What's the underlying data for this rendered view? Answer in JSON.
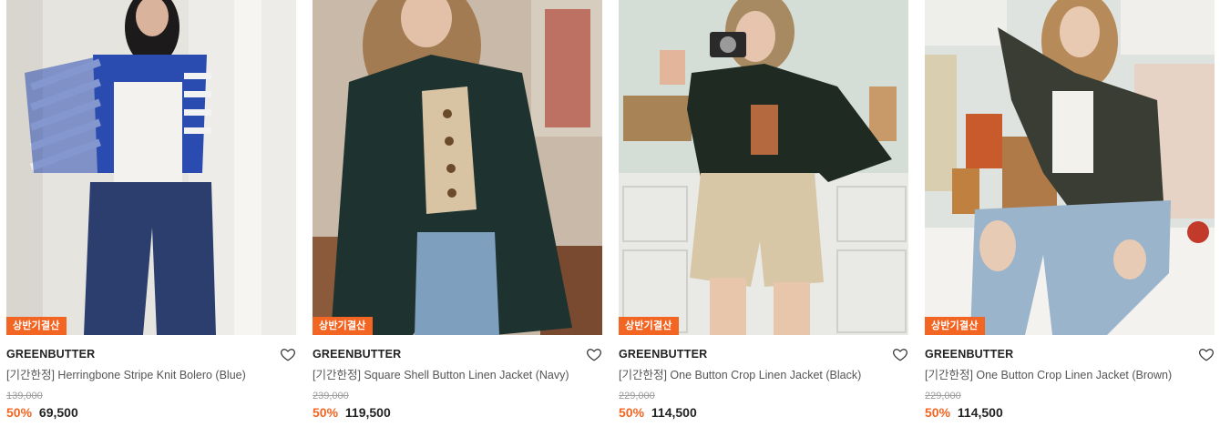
{
  "products": [
    {
      "badge": "상반기결산",
      "brand": "GREENBUTTER",
      "name": "[기간한정] Herringbone Stripe Knit Bolero (Blue)",
      "original_price": "139,000",
      "discount": "50%",
      "price": "69,500"
    },
    {
      "badge": "상반기결산",
      "brand": "GREENBUTTER",
      "name": "[기간한정] Square Shell Button Linen Jacket (Navy)",
      "original_price": "239,000",
      "discount": "50%",
      "price": "119,500"
    },
    {
      "badge": "상반기결산",
      "brand": "GREENBUTTER",
      "name": "[기간한정] One Button Crop Linen Jacket (Black)",
      "original_price": "229,000",
      "discount": "50%",
      "price": "114,500"
    },
    {
      "badge": "상반기결산",
      "brand": "GREENBUTTER",
      "name": "[기간한정] One Button Crop Linen Jacket (Brown)",
      "original_price": "229,000",
      "discount": "50%",
      "price": "114,500"
    }
  ],
  "colors": {
    "badge": "#f26522",
    "discount": "#f26522"
  },
  "icons": {
    "wishlist": "heart-outline-icon"
  }
}
